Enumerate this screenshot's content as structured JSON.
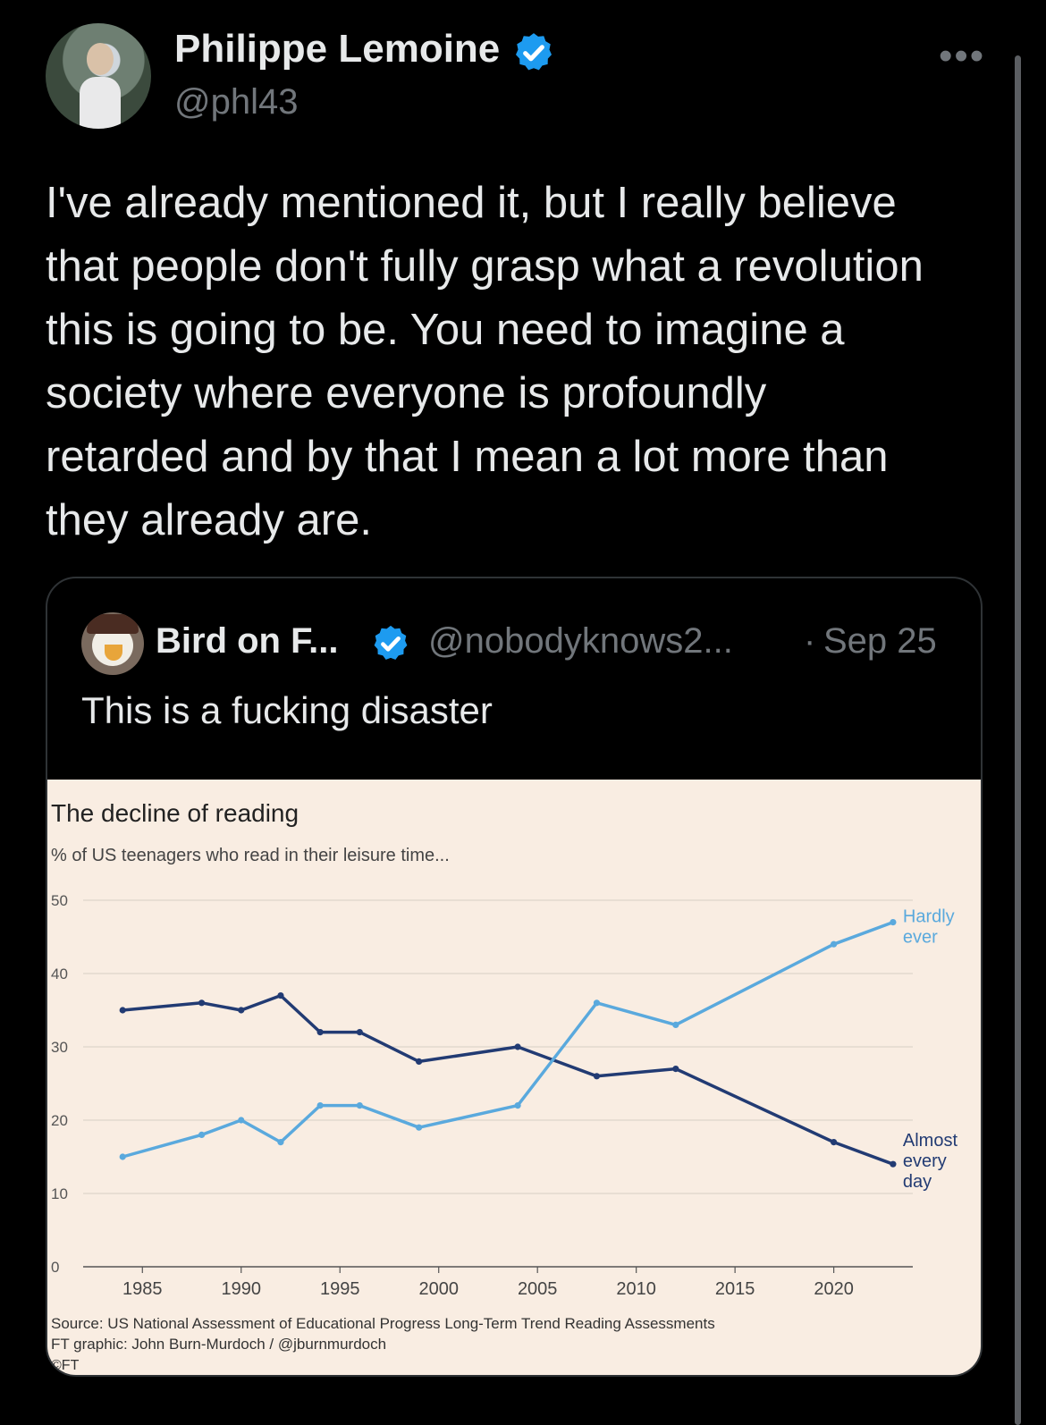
{
  "tweet": {
    "author_name": "Philippe Lemoine",
    "author_handle": "@phl43",
    "more_label": "•••",
    "text": "I've already mentioned it, but I really believe\nthat people don't fully grasp what a revolution\nthis is going to be. You need to imagine a\nsociety where everyone is profoundly\nretarded and by that I mean a lot more than\nthey already are."
  },
  "quote": {
    "author_name": "Bird on F...",
    "author_handle": "@nobodyknows2...",
    "separator": "·",
    "date": "Sep 25",
    "text": "This is a fucking disaster"
  },
  "colors": {
    "verified": "#1d9bf0",
    "chart_bg": "#f9ede2",
    "hardly_ever": "#5aa9dd",
    "almost_every_day": "#223b73"
  },
  "chart_data": {
    "type": "line",
    "title": "The decline of reading",
    "subtitle": "% of US teenagers who read in their leisure time...",
    "xlabel": "",
    "ylabel": "",
    "xlim": [
      1982,
      2024
    ],
    "ylim": [
      0,
      50
    ],
    "yticks": [
      "0",
      "10",
      "20",
      "30",
      "40",
      "50"
    ],
    "xticks": [
      "1985",
      "1990",
      "1995",
      "2000",
      "2005",
      "2010",
      "2015",
      "2020"
    ],
    "grid": true,
    "series": [
      {
        "name": "Almost every day",
        "label_lines": [
          "Almost",
          "every",
          "day"
        ],
        "color": "#223b73",
        "x": [
          1984,
          1988,
          1990,
          1992,
          1994,
          1996,
          1999,
          2004,
          2008,
          2012,
          2020,
          2023
        ],
        "y": [
          35,
          36,
          35,
          37,
          32,
          32,
          28,
          30,
          26,
          27,
          17,
          14
        ]
      },
      {
        "name": "Hardly ever",
        "label_lines": [
          "Hardly",
          "ever"
        ],
        "color": "#5aa9dd",
        "x": [
          1984,
          1988,
          1990,
          1992,
          1994,
          1996,
          1999,
          2004,
          2008,
          2012,
          2020,
          2023
        ],
        "y": [
          15,
          18,
          20,
          17,
          22,
          22,
          19,
          22,
          36,
          33,
          44,
          47
        ]
      }
    ],
    "source": "Source: US National Assessment of Educational Progress Long-Term Trend Reading Assessments",
    "credit": "FT graphic: John Burn-Murdoch / @jburnmurdoch",
    "logo": "©FT"
  }
}
